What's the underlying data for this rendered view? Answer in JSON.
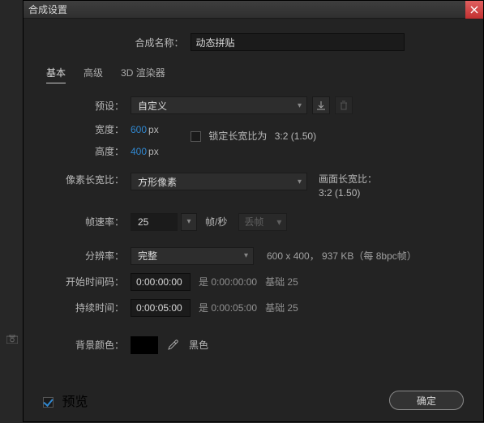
{
  "dialog": {
    "title": "合成设置",
    "comp_name_label": "合成名称：",
    "comp_name_value": "动态拼贴"
  },
  "tabs": {
    "basic": "基本",
    "advanced": "高级",
    "renderer": "3D 渲染器"
  },
  "preset": {
    "label": "预设：",
    "value": "自定义"
  },
  "dims": {
    "width_label": "宽度：",
    "width_value": "600",
    "width_unit": "px",
    "height_label": "高度：",
    "height_value": "400",
    "height_unit": "px",
    "lock_label": "锁定长宽比为",
    "lock_ratio": "3:2 (1.50)"
  },
  "par": {
    "label": "像素长宽比：",
    "value": "方形像素",
    "frame_label": "画面长宽比：",
    "frame_ratio": "3:2 (1.50)"
  },
  "rate": {
    "label": "帧速率：",
    "value": "25",
    "unit": "帧/秒",
    "drop": "丢帧"
  },
  "resolution": {
    "label": "分辨率：",
    "value": "完整",
    "note": "600 x 400， 937 KB（每 8bpc帧）"
  },
  "start": {
    "label": "开始时间码：",
    "value": "0:00:00:00",
    "note1": "是 0:00:00:00",
    "note2": "基础 25"
  },
  "duration": {
    "label": "持续时间：",
    "value": "0:00:05:00",
    "note1": "是 0:00:05:00",
    "note2": "基础 25"
  },
  "bg": {
    "label": "背景颜色：",
    "name": "黑色",
    "color": "#000000"
  },
  "footer": {
    "preview": "预览",
    "ok": "确定"
  }
}
